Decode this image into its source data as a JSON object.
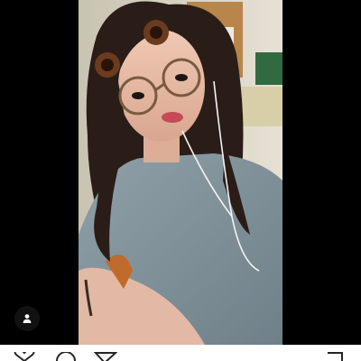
{
  "post": {
    "image": {
      "subject": "selfie-photo"
    },
    "tag_indicator": {
      "icon": "user-tag-icon"
    }
  },
  "actions": [
    {
      "icon": "heart-icon"
    },
    {
      "icon": "comment-icon"
    },
    {
      "icon": "share-icon"
    },
    {
      "icon": "bookmark-icon"
    }
  ],
  "colors": {
    "background": "#000000",
    "action_bar": "#ffffff"
  }
}
